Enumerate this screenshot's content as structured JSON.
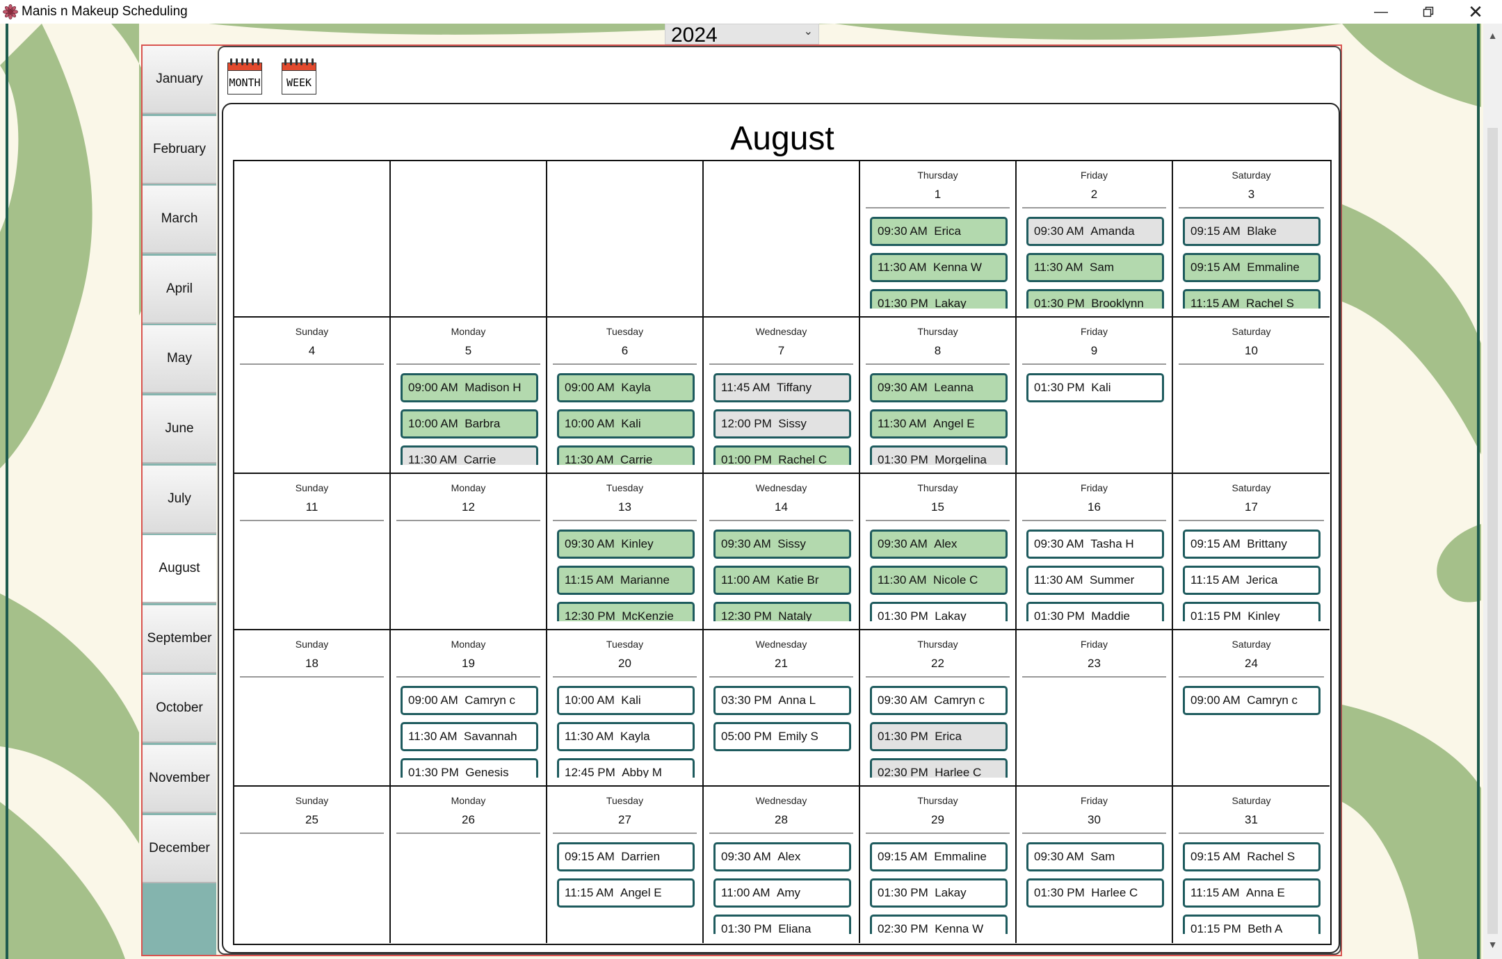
{
  "window": {
    "title": "Manis n Makeup Scheduling"
  },
  "year_select": {
    "value": "2024"
  },
  "months": [
    "January",
    "February",
    "March",
    "April",
    "May",
    "June",
    "July",
    "August",
    "September",
    "October",
    "November",
    "December"
  ],
  "active_month": "August",
  "view_buttons": {
    "month": "MONTH",
    "week": "WEEK"
  },
  "calendar": {
    "title": "August",
    "weeks": [
      [
        null,
        null,
        null,
        null,
        {
          "weekday": "Thursday",
          "day": "1",
          "appts": [
            {
              "time": "09:30 AM",
              "name": "Erica",
              "status": "green"
            },
            {
              "time": "11:30 AM",
              "name": "Kenna W",
              "status": "green"
            },
            {
              "time": "01:30 PM",
              "name": "Lakay",
              "status": "green"
            }
          ]
        },
        {
          "weekday": "Friday",
          "day": "2",
          "appts": [
            {
              "time": "09:30 AM",
              "name": "Amanda",
              "status": "gray"
            },
            {
              "time": "11:30 AM",
              "name": "Sam",
              "status": "green"
            },
            {
              "time": "01:30 PM",
              "name": "Brooklynn",
              "status": "green"
            }
          ]
        },
        {
          "weekday": "Saturday",
          "day": "3",
          "appts": [
            {
              "time": "09:15 AM",
              "name": "Blake",
              "status": "gray"
            },
            {
              "time": "09:15 AM",
              "name": "Emmaline",
              "status": "green"
            },
            {
              "time": "11:15 AM",
              "name": "Rachel S",
              "status": "green"
            }
          ]
        }
      ],
      [
        {
          "weekday": "Sunday",
          "day": "4",
          "appts": []
        },
        {
          "weekday": "Monday",
          "day": "5",
          "appts": [
            {
              "time": "09:00 AM",
              "name": "Madison H",
              "status": "green"
            },
            {
              "time": "10:00 AM",
              "name": "Barbra",
              "status": "green"
            },
            {
              "time": "11:30 AM",
              "name": "Carrie",
              "status": "gray"
            }
          ]
        },
        {
          "weekday": "Tuesday",
          "day": "6",
          "appts": [
            {
              "time": "09:00 AM",
              "name": "Kayla",
              "status": "green"
            },
            {
              "time": "10:00 AM",
              "name": "Kali",
              "status": "green"
            },
            {
              "time": "11:30 AM",
              "name": "Carrie",
              "status": "green"
            }
          ]
        },
        {
          "weekday": "Wednesday",
          "day": "7",
          "appts": [
            {
              "time": "11:45 AM",
              "name": "Tiffany",
              "status": "gray"
            },
            {
              "time": "12:00 PM",
              "name": "Sissy",
              "status": "gray"
            },
            {
              "time": "01:00 PM",
              "name": "Rachel C",
              "status": "green"
            }
          ]
        },
        {
          "weekday": "Thursday",
          "day": "8",
          "appts": [
            {
              "time": "09:30 AM",
              "name": "Leanna",
              "status": "green"
            },
            {
              "time": "11:30 AM",
              "name": "Angel E",
              "status": "green"
            },
            {
              "time": "01:30 PM",
              "name": "Morgelina",
              "status": "gray"
            }
          ]
        },
        {
          "weekday": "Friday",
          "day": "9",
          "appts": [
            {
              "time": "01:30 PM",
              "name": "Kali",
              "status": "white"
            }
          ]
        },
        {
          "weekday": "Saturday",
          "day": "10",
          "appts": []
        }
      ],
      [
        {
          "weekday": "Sunday",
          "day": "11",
          "appts": []
        },
        {
          "weekday": "Monday",
          "day": "12",
          "appts": []
        },
        {
          "weekday": "Tuesday",
          "day": "13",
          "appts": [
            {
              "time": "09:30 AM",
              "name": "Kinley",
              "status": "green"
            },
            {
              "time": "11:15 AM",
              "name": "Marianne",
              "status": "green"
            },
            {
              "time": "12:30 PM",
              "name": "McKenzie",
              "status": "green"
            }
          ]
        },
        {
          "weekday": "Wednesday",
          "day": "14",
          "appts": [
            {
              "time": "09:30 AM",
              "name": "Sissy",
              "status": "green"
            },
            {
              "time": "11:00 AM",
              "name": "Katie Br",
              "status": "green"
            },
            {
              "time": "12:30 PM",
              "name": "Nataly",
              "status": "green"
            }
          ]
        },
        {
          "weekday": "Thursday",
          "day": "15",
          "appts": [
            {
              "time": "09:30 AM",
              "name": "Alex",
              "status": "green"
            },
            {
              "time": "11:30 AM",
              "name": "Nicole C",
              "status": "green"
            },
            {
              "time": "01:30 PM",
              "name": "Lakay",
              "status": "white"
            }
          ]
        },
        {
          "weekday": "Friday",
          "day": "16",
          "appts": [
            {
              "time": "09:30 AM",
              "name": "Tasha H",
              "status": "white"
            },
            {
              "time": "11:30 AM",
              "name": "Summer",
              "status": "white"
            },
            {
              "time": "01:30 PM",
              "name": "Maddie",
              "status": "white"
            }
          ]
        },
        {
          "weekday": "Saturday",
          "day": "17",
          "appts": [
            {
              "time": "09:15 AM",
              "name": "Brittany",
              "status": "white"
            },
            {
              "time": "11:15 AM",
              "name": "Jerica",
              "status": "white"
            },
            {
              "time": "01:15 PM",
              "name": "Kinley",
              "status": "white"
            }
          ]
        }
      ],
      [
        {
          "weekday": "Sunday",
          "day": "18",
          "appts": []
        },
        {
          "weekday": "Monday",
          "day": "19",
          "appts": [
            {
              "time": "09:00 AM",
              "name": "Camryn c",
              "status": "white"
            },
            {
              "time": "11:30 AM",
              "name": "Savannah",
              "status": "white"
            },
            {
              "time": "01:30 PM",
              "name": "Genesis",
              "status": "white"
            }
          ]
        },
        {
          "weekday": "Tuesday",
          "day": "20",
          "appts": [
            {
              "time": "10:00 AM",
              "name": "Kali",
              "status": "white"
            },
            {
              "time": "11:30 AM",
              "name": "Kayla",
              "status": "white"
            },
            {
              "time": "12:45 PM",
              "name": "Abby M",
              "status": "white"
            }
          ]
        },
        {
          "weekday": "Wednesday",
          "day": "21",
          "appts": [
            {
              "time": "03:30 PM",
              "name": "Anna L",
              "status": "white"
            },
            {
              "time": "05:00 PM",
              "name": "Emily S",
              "status": "white"
            }
          ]
        },
        {
          "weekday": "Thursday",
          "day": "22",
          "appts": [
            {
              "time": "09:30 AM",
              "name": "Camryn c",
              "status": "white"
            },
            {
              "time": "01:30 PM",
              "name": "Erica",
              "status": "gray"
            },
            {
              "time": "02:30 PM",
              "name": "Harlee C",
              "status": "gray"
            }
          ]
        },
        {
          "weekday": "Friday",
          "day": "23",
          "appts": []
        },
        {
          "weekday": "Saturday",
          "day": "24",
          "appts": [
            {
              "time": "09:00 AM",
              "name": "Camryn c",
              "status": "white"
            }
          ]
        }
      ],
      [
        {
          "weekday": "Sunday",
          "day": "25",
          "appts": []
        },
        {
          "weekday": "Monday",
          "day": "26",
          "appts": []
        },
        {
          "weekday": "Tuesday",
          "day": "27",
          "appts": [
            {
              "time": "09:15 AM",
              "name": "Darrien",
              "status": "white"
            },
            {
              "time": "11:15 AM",
              "name": "Angel E",
              "status": "white"
            }
          ]
        },
        {
          "weekday": "Wednesday",
          "day": "28",
          "appts": [
            {
              "time": "09:30 AM",
              "name": "Alex",
              "status": "white"
            },
            {
              "time": "11:00 AM",
              "name": "Amy",
              "status": "white"
            },
            {
              "time": "01:30 PM",
              "name": "Eliana",
              "status": "white"
            }
          ]
        },
        {
          "weekday": "Thursday",
          "day": "29",
          "appts": [
            {
              "time": "09:15 AM",
              "name": "Emmaline",
              "status": "white"
            },
            {
              "time": "01:30 PM",
              "name": "Lakay",
              "status": "white"
            },
            {
              "time": "02:30 PM",
              "name": "Kenna W",
              "status": "white"
            }
          ]
        },
        {
          "weekday": "Friday",
          "day": "30",
          "appts": [
            {
              "time": "09:30 AM",
              "name": "Sam",
              "status": "white"
            },
            {
              "time": "01:30 PM",
              "name": "Harlee C",
              "status": "white"
            }
          ]
        },
        {
          "weekday": "Saturday",
          "day": "31",
          "appts": [
            {
              "time": "09:15 AM",
              "name": "Rachel S",
              "status": "white"
            },
            {
              "time": "11:15 AM",
              "name": "Anna E",
              "status": "white"
            },
            {
              "time": "01:15 PM",
              "name": "Beth A",
              "status": "white"
            }
          ]
        }
      ]
    ]
  },
  "colors": {
    "accent_green": "#b3d9ae",
    "appt_gray": "#e2e2e2",
    "appt_border": "#1e5b5e",
    "panel_border": "#d9534f",
    "sidebar_fill": "#84b4ae",
    "background_cream": "#faf7e8",
    "background_swirl": "#a5c08a"
  }
}
